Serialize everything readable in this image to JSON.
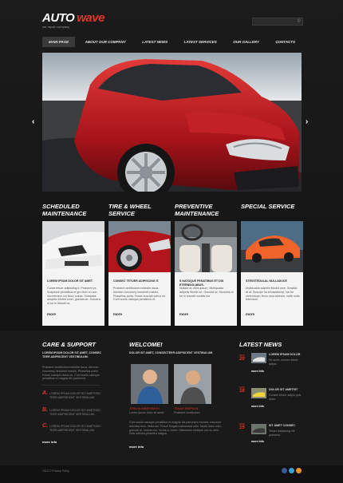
{
  "header": {
    "logo_part1": "AUTO",
    "logo_part2": "wave",
    "tagline": "car repair company"
  },
  "nav": [
    {
      "label": "MAIN PAGE",
      "active": true
    },
    {
      "label": "ABOUT OUR COMPANY",
      "active": false
    },
    {
      "label": "LATEST NEWS",
      "active": false
    },
    {
      "label": "LATEST SERVICES",
      "active": false
    },
    {
      "label": "OUR GALLERY",
      "active": false
    },
    {
      "label": "CONTACTS",
      "active": false
    }
  ],
  "slider": {
    "prev": "‹",
    "next": "›"
  },
  "services": [
    {
      "title": "SCHEDULED MAINTENANCE",
      "head": "LOREM IPSUM DOLOR SIT AMET.",
      "text": "Conse tetuer adipiscing it. Praesent ve. Suspesse penatibus et grn dnm nn oun necmtenem cot Nunc soluta. Suissada adoptes Morbit umet, gravida ae. Suscens ut tor in blandit ac.",
      "more": "more"
    },
    {
      "title": "TIRE & WHEEL SERVICE",
      "head": "CONSEC TETUER ADIPISCING IT.",
      "text": "Praesent vestibulum molestie lacus. Aenean nonummy hendrerit mauris. Phasellus porta. Fusce suscipit varius mi. Cum sociis natoque penatibus et.",
      "more": "more"
    },
    {
      "title": "PREVENTIVE MAINTENANCE",
      "head": "S NATOQUE PENATIBUS ET DIS ETERNSOLABUS.",
      "text": "Nullam ac ribus ipsum. Mulequada adipelis Morbit urt. Gravida ac, Suscens ut tor in blandit morbits ine.",
      "more": "more"
    },
    {
      "title": "SPECIAL SERVICE",
      "head": "STESSTEDULAL NULLADUCE",
      "text": "Mulesuada adipelis Morbit ume, Gravida at at. Suscipe ha lenusdelemp, ine tor utelentmpe, Nunc lusa selestur, vutte nulla bibentum.",
      "more": "more"
    }
  ],
  "care": {
    "title": "CARE & SUPPORT",
    "intro": "LOREM IPSUM DOLOR SIT AMET, CONSEC TEER ADIPISCENT VESTIBULUM.",
    "intro_text": "Praesent vestibulum molestie lacus. Aenean nonummy hendrerit mauris. Phasellus porta. Fusce suscipit varius mi. Cum sociis natoque penatibus et magnis dis parturient.",
    "items": [
      {
        "letter": "A.",
        "text": "LOREM IPSUM DOLOR SIT AMETISEC TEER ADIPISCENT VESTIBULUM."
      },
      {
        "letter": "B.",
        "text": "LOREM IPSUM DOLOR SIT AMETISEC TEER ADIPISCENT VESTIBULUM."
      },
      {
        "letter": "C.",
        "text": "LOREM IPSUM DOLOR SIT AMETISEC TEER ADIPISCENT VESTIBULUM."
      }
    ],
    "more": "more info"
  },
  "welcome": {
    "title": "WELCOME!",
    "intro": "DOLOR SIT AMET, CONSECTEER ADIPISCENT VESTIBULUM.",
    "person1_name": "JOHN SUMMERSMITH",
    "person1_text": "Lorem ipsum dolor sit amet",
    "person2_name": "TOMAS SIMPSON",
    "person2_text": "Praesent vestibulum",
    "body": "Cum sociis natoque penatibus et magnis dis parturient montes, nascetur ridiculus mus. Nulla dui. Fusce feugiat malesuada odio. Morbi nunc odio, gravida at, cursus nec, luctus a, lorem. Maecenas tristique orci ac sem. Duis ultricies pharetra magna.",
    "more": "more info"
  },
  "news": {
    "title": "LATEST NEWS",
    "items": [
      {
        "month": "june",
        "day": "20",
        "head": "LOREM IPSUM DOLOR",
        "text": "Sit amet, consec tetuer adipis.",
        "more": "more info"
      },
      {
        "month": "june",
        "day": "18",
        "head": "DOLOR SIT AMETSIT",
        "text": "Consec tetuer adipis quis dolor.",
        "more": "more info"
      },
      {
        "month": "june",
        "day": "15",
        "head": "SIT AMET CONSEC",
        "text": "Tetuer adipiscing elit praesent.",
        "more": "more info"
      }
    ]
  },
  "footer": {
    "copyright": "2013 © Privacy Policy"
  },
  "colors": {
    "accent": "#e3352b",
    "background": "#141414",
    "card": "#f4f4f4"
  },
  "icons": [
    "search-icon",
    "facebook-icon",
    "twitter-icon",
    "rss-icon"
  ]
}
